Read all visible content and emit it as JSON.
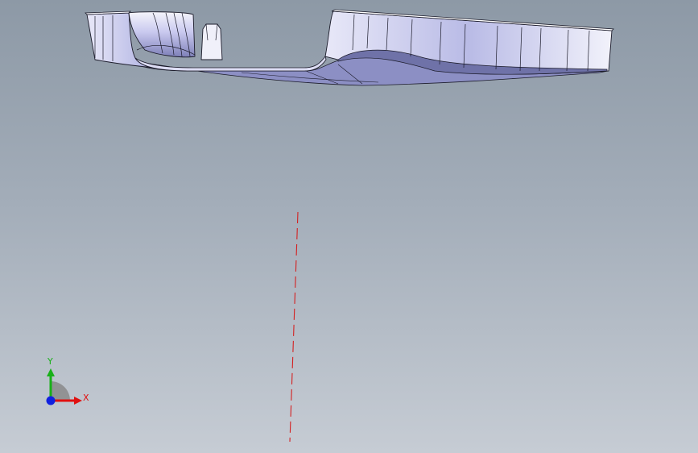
{
  "viewport": {
    "background_top": "#8d99a6",
    "background_bottom": "#c6ccd4"
  },
  "model": {
    "description_icon": "sheet-metal-part-icon",
    "face_color": "#c7c8f2",
    "edge_color": "#1b1b2a"
  },
  "sketch_line": {
    "style": "dashed",
    "color": "#d42020"
  },
  "triad": {
    "x_label": "X",
    "y_label": "Y",
    "x_color": "#e01010",
    "y_color": "#18b018",
    "z_color": "#1020e0"
  }
}
